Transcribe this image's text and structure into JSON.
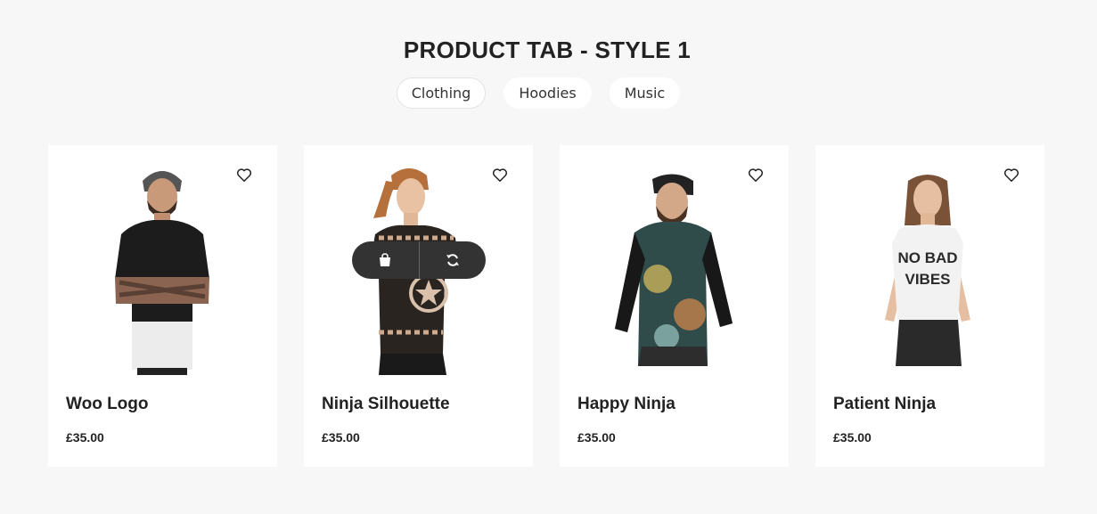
{
  "section": {
    "title": "PRODUCT TAB - STYLE 1"
  },
  "tabs": [
    {
      "label": "Clothing",
      "active": true
    },
    {
      "label": "Hoodies",
      "active": false
    },
    {
      "label": "Music",
      "active": false
    }
  ],
  "products": [
    {
      "name": "Woo Logo",
      "price": "£35.00",
      "shirt_color": "#1c1c1c",
      "lower_color": "#ececec"
    },
    {
      "name": "Ninja Silhouette",
      "price": "£35.00",
      "shirt_color": "#2a2421",
      "lower_color": "#1a1a1a"
    },
    {
      "name": "Happy Ninja",
      "price": "£35.00",
      "shirt_color": "#2f4b4a",
      "lower_color": "#2d2d2d"
    },
    {
      "name": "Patient Ninja",
      "price": "£35.00",
      "shirt_color": "#f2f2f2",
      "lower_color": "#2a2a2a",
      "shirt_text_line1": "NO BAD",
      "shirt_text_line2": "VIBES"
    }
  ],
  "hover_actions": {
    "add_to_cart_icon": "shopping-bag-icon",
    "compare_icon": "refresh-icon"
  },
  "icons": {
    "wishlist": "heart-outline-icon"
  }
}
